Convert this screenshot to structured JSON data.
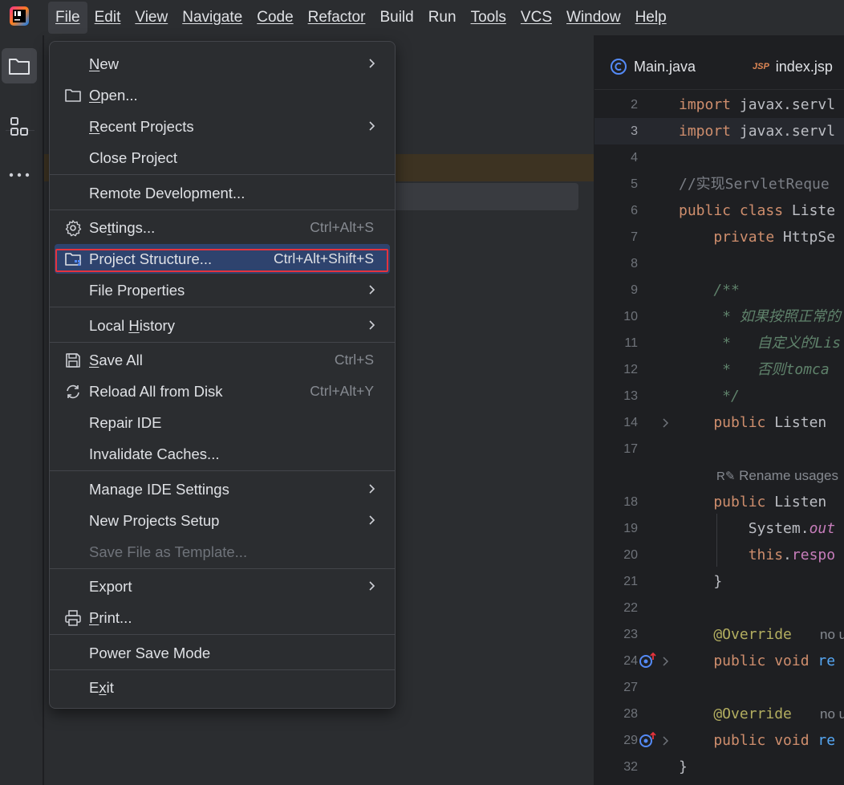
{
  "menubar": {
    "items": [
      {
        "label": "File",
        "active": true
      },
      {
        "label": "Edit"
      },
      {
        "label": "View"
      },
      {
        "label": "Navigate"
      },
      {
        "label": "Code"
      },
      {
        "label": "Refactor"
      },
      {
        "label": "Build"
      },
      {
        "label": "Run"
      },
      {
        "label": "Tools"
      },
      {
        "label": "VCS"
      },
      {
        "label": "Window"
      },
      {
        "label": "Help"
      }
    ]
  },
  "left_toolbar": {
    "icons": [
      "folder-icon",
      "structure-icon",
      "more-icon"
    ]
  },
  "editor": {
    "tabs": [
      {
        "label": "Main.java",
        "icon": "java-class-icon"
      },
      {
        "label": "index.jsp",
        "icon": "jsp-icon",
        "icon_text": "JSP"
      }
    ],
    "inlay_hints": {
      "rename": "Rename usages",
      "no_usages_1": "no u",
      "no_usages_2": "no u"
    },
    "line_numbers": [
      "2",
      "3",
      "4",
      "5",
      "6",
      "7",
      "8",
      "9",
      "10",
      "11",
      "12",
      "13",
      "14",
      "17",
      "18",
      "19",
      "20",
      "21",
      "22",
      "23",
      "24",
      "27",
      "28",
      "29",
      "32"
    ],
    "code": {
      "l2_kw": "import ",
      "l2": "javax.servl",
      "l3_kw": "import ",
      "l3": "javax.servl",
      "l5": "//实现ServletReque",
      "l6_kw": "public class ",
      "l6": "Liste",
      "l7_kw": "    private ",
      "l7": "HttpSe",
      "l9": "    /**",
      "l10": "     * 如果按照正常的",
      "l11": "     *   自定义的Lis",
      "l12": "     *   否则tomca",
      "l13": "     */",
      "l14_kw": "    public ",
      "l14": "Listen",
      "l18_kw": "    public ",
      "l18": "Listen",
      "l19_a": "        System.",
      "l19_b": "out",
      "l20_a": "        this",
      "l20_b": ".",
      "l20_c": "respo",
      "l21": "    }",
      "l23": "    @Override",
      "l24_kw": "    public void ",
      "l24": "re",
      "l28": "    @Override",
      "l29_kw": "    public void ",
      "l29": "re",
      "l32": "}"
    }
  },
  "file_menu": {
    "items": [
      {
        "label": "New",
        "mnemonic": "N",
        "submenu": true
      },
      {
        "label": "Open...",
        "mnemonic": "O",
        "icon": "folder-open-icon"
      },
      {
        "label": "Recent Projects",
        "mnemonic": "R",
        "submenu": true
      },
      {
        "label": "Close Project"
      },
      {
        "label": "Remote Development..."
      },
      {
        "label": "Settings...",
        "mnemonic": "t",
        "icon": "gear-icon",
        "shortcut": "Ctrl+Alt+S"
      },
      {
        "label": "Project Structure...",
        "icon": "project-structure-icon",
        "shortcut": "Ctrl+Alt+Shift+S",
        "selected": true
      },
      {
        "label": "File Properties",
        "submenu": true
      },
      {
        "label": "Local History",
        "mnemonic": "H",
        "submenu": true
      },
      {
        "label": "Save All",
        "mnemonic": "S",
        "icon": "save-icon",
        "shortcut": "Ctrl+S"
      },
      {
        "label": "Reload All from Disk",
        "icon": "reload-icon",
        "shortcut": "Ctrl+Alt+Y"
      },
      {
        "label": "Repair IDE"
      },
      {
        "label": "Invalidate Caches..."
      },
      {
        "label": "Manage IDE Settings",
        "submenu": true
      },
      {
        "label": "New Projects Setup",
        "submenu": true
      },
      {
        "label": "Save File as Template...",
        "disabled": true
      },
      {
        "label": "Export",
        "submenu": true
      },
      {
        "label": "Print...",
        "mnemonic": "P",
        "icon": "print-icon"
      },
      {
        "label": "Power Save Mode"
      },
      {
        "label": "Exit",
        "mnemonic": "x"
      }
    ]
  },
  "colors": {
    "accent": "#2e436e",
    "highlight_box": "#e5333d"
  }
}
